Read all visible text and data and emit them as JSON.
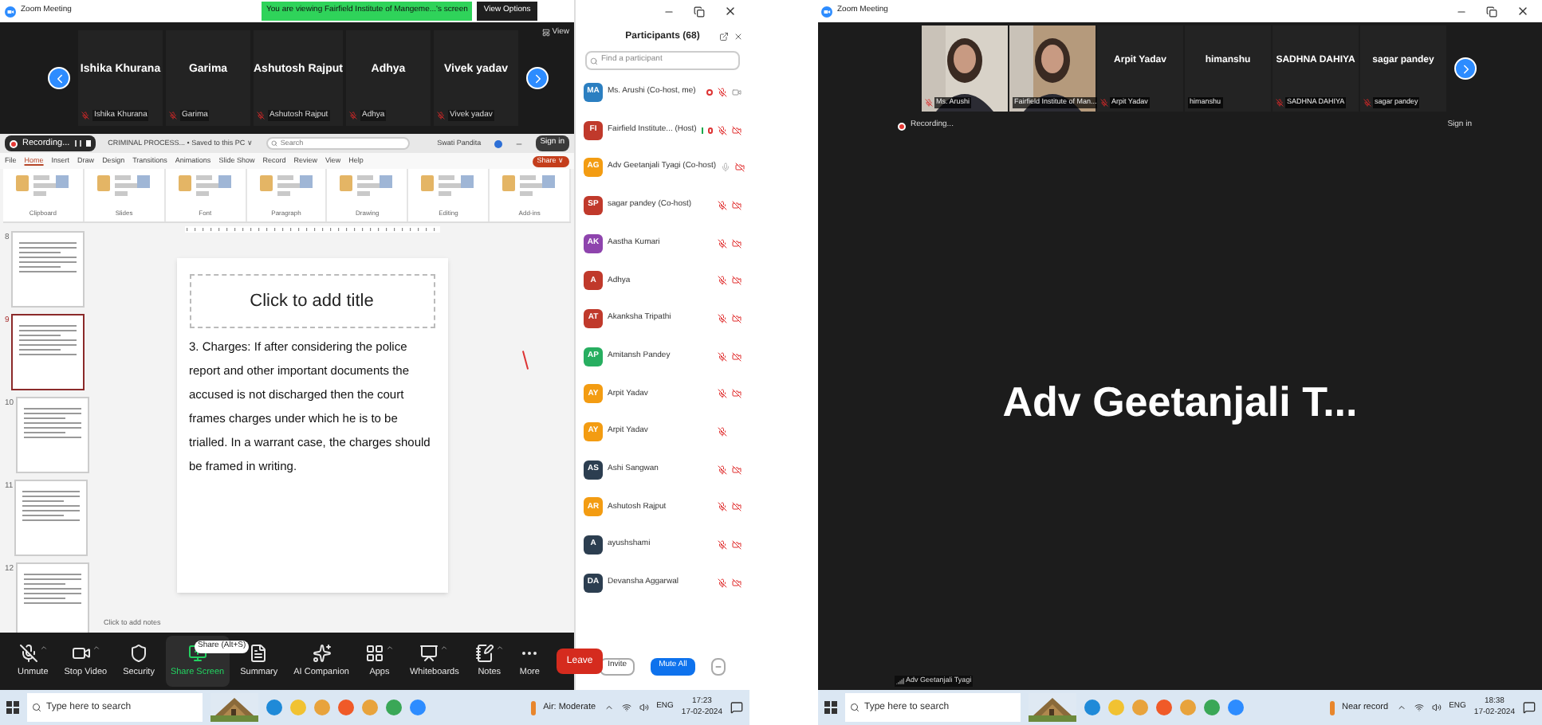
{
  "left_window": {
    "title": "Zoom Meeting",
    "share_banner": "You are viewing Fairfield Institute of Mangeme...'s screen",
    "view_options": "View Options",
    "view": "View",
    "gallery": [
      {
        "name": "Ishika Khurana",
        "label": "Ishika Khurana",
        "muted": true
      },
      {
        "name": "Garima",
        "label": "Garima",
        "muted": true
      },
      {
        "name": "Ashutosh Rajput",
        "label": "Ashutosh Rajput",
        "muted": true
      },
      {
        "name": "Adhya",
        "label": "Adhya",
        "muted": true
      },
      {
        "name": "Vivek yadav",
        "label": "Vivek yadav",
        "muted": true
      }
    ],
    "shared_screen": {
      "recording": "Recording...",
      "doc_title": "CRIMINAL PROCESS... • Saved to this PC ∨",
      "search_placeholder": "Search",
      "user": "Swati Pandita",
      "sign_in": "Sign in",
      "menu": [
        {
          "label": "File",
          "selected": false
        },
        {
          "label": "Home",
          "selected": true
        },
        {
          "label": "Insert",
          "selected": false
        },
        {
          "label": "Draw",
          "selected": false
        },
        {
          "label": "Design",
          "selected": false
        },
        {
          "label": "Transitions",
          "selected": false
        },
        {
          "label": "Animations",
          "selected": false
        },
        {
          "label": "Slide Show",
          "selected": false
        },
        {
          "label": "Record",
          "selected": false
        },
        {
          "label": "Review",
          "selected": false
        },
        {
          "label": "View",
          "selected": false
        },
        {
          "label": "Help",
          "selected": false
        }
      ],
      "share": "Share ∨",
      "ribbon_groups": [
        "Clipboard",
        "Slides",
        "Font",
        "Paragraph",
        "Drawing",
        "Editing",
        "Add-ins"
      ],
      "slides": [
        {
          "number": "8",
          "selected": false
        },
        {
          "number": "9",
          "selected": true
        },
        {
          "number": "10",
          "selected": false
        },
        {
          "number": "11",
          "selected": false
        },
        {
          "number": "12",
          "selected": false
        }
      ],
      "title_placeholder": "Click to add title",
      "body": "3. Charges: If after considering the police report and other important documents the accused is not discharged then the court frames charges under which he is to be trialled. In a warrant case, the charges should be framed in writing.",
      "notes_placeholder": "Click to add notes"
    },
    "toolbar": [
      {
        "kind": "mic",
        "label": "Unmute",
        "caret": true,
        "selected": false
      },
      {
        "kind": "video",
        "label": "Stop Video",
        "caret": true,
        "selected": false
      },
      {
        "kind": "shield",
        "label": "Security",
        "caret": false,
        "selected": false
      },
      {
        "kind": "share",
        "label": "Share Screen",
        "caret": false,
        "selected": true
      },
      {
        "kind": "summary",
        "label": "Summary",
        "caret": false,
        "selected": false
      },
      {
        "kind": "sparkle",
        "label": "AI Companion",
        "caret": false,
        "selected": false
      },
      {
        "kind": "apps",
        "label": "Apps",
        "caret": true,
        "selected": false
      },
      {
        "kind": "whiteboard",
        "label": "Whiteboards",
        "caret": true,
        "selected": false
      },
      {
        "kind": "notes",
        "label": "Notes",
        "caret": true,
        "selected": false
      },
      {
        "kind": "more",
        "label": "More",
        "caret": false,
        "selected": false
      }
    ],
    "tooltip": "Share (Alt+S)",
    "leave": "Leave",
    "participants": {
      "title": "Participants (68)",
      "search_placeholder": "Find a participant",
      "list": [
        {
          "initials": "MA",
          "name": "Ms. Arushi (Co-host, me)",
          "color": "#2b7fc1",
          "recording": true,
          "badge": false,
          "muted": true,
          "video_icon": true,
          "video_off": false
        },
        {
          "initials": "FI",
          "name": "Fairfield Institute... (Host)",
          "color": "#c0392b",
          "recording": true,
          "badge": true,
          "muted": true,
          "video_icon": true,
          "video_off": true
        },
        {
          "initials": "AG",
          "name": "Adv Geetanjali Tyagi (Co-host)",
          "color": "#f39c12",
          "recording": false,
          "badge": false,
          "muted": false,
          "video_icon": true,
          "video_off": true
        },
        {
          "initials": "SP",
          "name": "sagar pandey (Co-host)",
          "color": "#c0392b",
          "recording": false,
          "badge": false,
          "muted": true,
          "video_icon": true,
          "video_off": true
        },
        {
          "initials": "AK",
          "name": "Aastha Kumari",
          "color": "#8e44ad",
          "recording": false,
          "badge": false,
          "muted": true,
          "video_icon": true,
          "video_off": true
        },
        {
          "initials": "A",
          "name": "Adhya",
          "color": "#c0392b",
          "recording": false,
          "badge": false,
          "muted": true,
          "video_icon": true,
          "video_off": true
        },
        {
          "initials": "AT",
          "name": "Akanksha Tripathi",
          "color": "#c0392b",
          "recording": false,
          "badge": false,
          "muted": true,
          "video_icon": true,
          "video_off": true
        },
        {
          "initials": "AP",
          "name": "Amitansh Pandey",
          "color": "#27ae60",
          "recording": false,
          "badge": false,
          "muted": true,
          "video_icon": true,
          "video_off": true
        },
        {
          "initials": "AY",
          "name": "Arpit Yadav",
          "color": "#f39c12",
          "recording": false,
          "badge": false,
          "muted": true,
          "video_icon": true,
          "video_off": true
        },
        {
          "initials": "AY",
          "name": "Arpit Yadav",
          "color": "#f39c12",
          "recording": false,
          "badge": false,
          "muted": true,
          "video_icon": false
        },
        {
          "initials": "AS",
          "name": "Ashi Sangwan",
          "color": "#2c3e50",
          "recording": false,
          "badge": false,
          "muted": true,
          "video_icon": true,
          "video_off": true
        },
        {
          "initials": "AR",
          "name": "Ashutosh Rajput",
          "color": "#f39c12",
          "recording": false,
          "badge": false,
          "muted": true,
          "video_icon": true,
          "video_off": true
        },
        {
          "initials": "A",
          "name": "ayushshami",
          "color": "#2c3e50",
          "recording": false,
          "badge": false,
          "muted": true,
          "video_icon": true,
          "video_off": true
        },
        {
          "initials": "DA",
          "name": "Devansha Aggarwal",
          "color": "#2c3e50",
          "recording": false,
          "badge": false,
          "muted": true,
          "video_icon": true,
          "video_off": true
        }
      ],
      "invite": "Invite",
      "mute_all": "Mute All"
    },
    "taskbar": {
      "search_placeholder": "Type here to search",
      "weather": "Air: Moderate",
      "language": "ENG",
      "time": "17:23",
      "date": "17-02-2024"
    }
  },
  "right_window": {
    "title": "Zoom Meeting",
    "tiles": [
      {
        "kind": "video",
        "label": "Ms. Arushi",
        "muted": true
      },
      {
        "kind": "video",
        "label": "Fairfield Institute of Man...",
        "muted": false
      },
      {
        "kind": "name",
        "name": "Arpit Yadav",
        "label": "Arpit Yadav",
        "muted": true
      },
      {
        "kind": "name",
        "name": "himanshu",
        "label": "himanshu",
        "muted": false
      },
      {
        "kind": "name",
        "name": "SADHNA DAHIYA",
        "label": "SADHNA DAHIYA",
        "muted": true
      },
      {
        "kind": "name",
        "name": "sagar pandey",
        "label": "sagar pandey",
        "muted": true
      }
    ],
    "recording": "Recording...",
    "sign_in": "Sign in",
    "speaker": "Adv Geetanjali T...",
    "speaker_label": "Adv Geetanjali Tyagi",
    "taskbar": {
      "search_placeholder": "Type here to search",
      "weather": "Near record",
      "language": "ENG",
      "time": "18:38",
      "date": "17-02-2024"
    }
  }
}
